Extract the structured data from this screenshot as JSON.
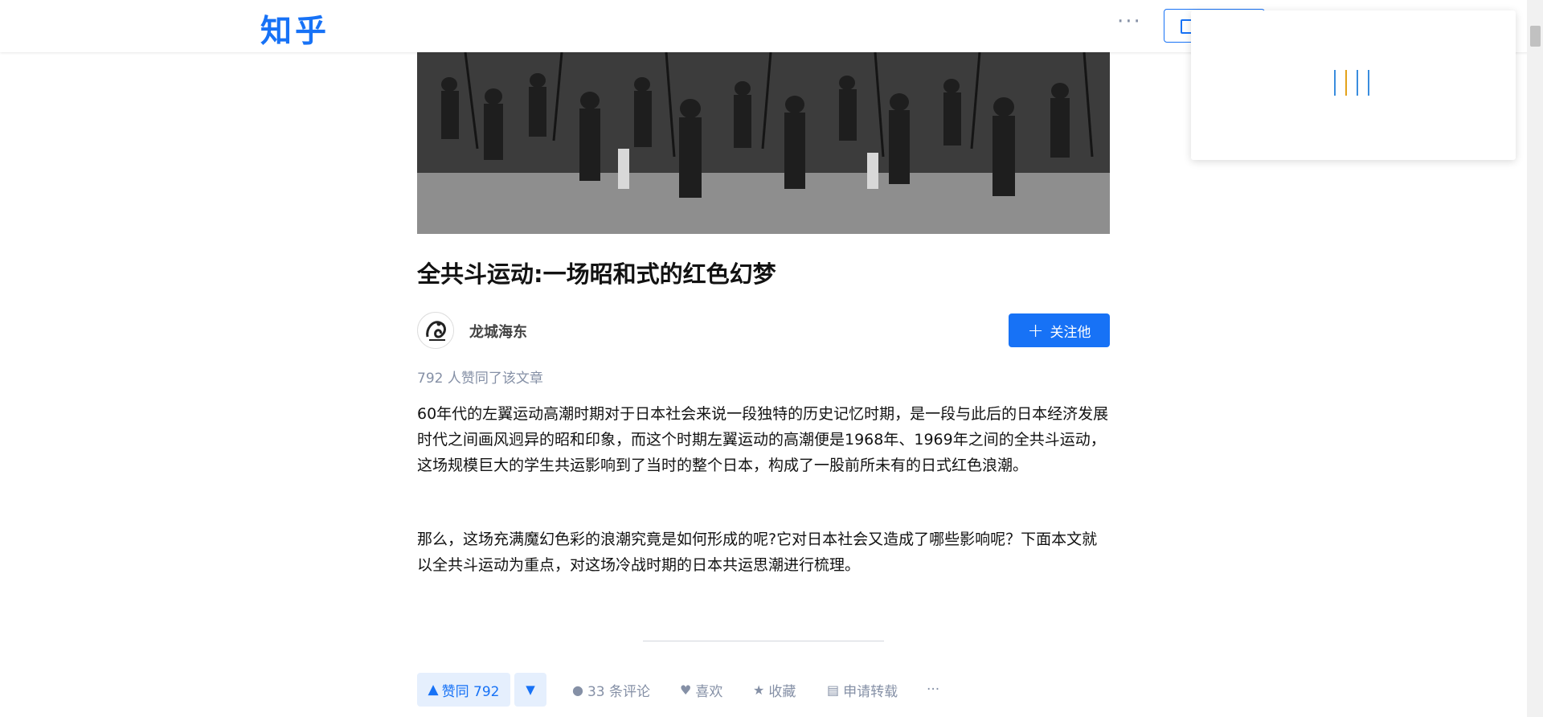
{
  "header": {
    "logo": "知乎",
    "more_icon": "more-dots-icon",
    "write_icon": "pen-icon"
  },
  "popup": {
    "loader_colors": [
      "#3a8dde",
      "#e4a21a",
      "#3a8dde",
      "#3a8dde"
    ]
  },
  "article": {
    "title": "全共斗运动:一场昭和式的红色幻梦",
    "author": {
      "name": "龙城海东",
      "follow_label": "关注他"
    },
    "upvote_summary": "792 人赞同了该文章",
    "paragraphs": [
      "60年代的左翼运动高潮时期对于日本社会来说一段独特的历史记忆时期，是一段与此后的日本经济发展时代之间画风迥异的昭和印象，而这个时期左翼运动的高潮便是1968年、1969年之间的全共斗运动，这场规模巨大的学生共运影响到了当时的整个日本，构成了一股前所未有的日式红色浪潮。",
      "那么，这场充满魔幻色彩的浪潮究竟是如何形成的呢?它对日本社会又造成了哪些影响呢？下面本文就以全共斗运动为重点，对这场冷战时期的日本共运思潮进行梳理。"
    ]
  },
  "actions": {
    "upvote_label": "赞同 792",
    "comments_label": "33 条评论",
    "like_label": "喜欢",
    "collect_label": "收藏",
    "repost_label": "申请转载",
    "more_label": "···"
  },
  "colors": {
    "brand": "#1772f6",
    "muted": "#8590a6"
  }
}
